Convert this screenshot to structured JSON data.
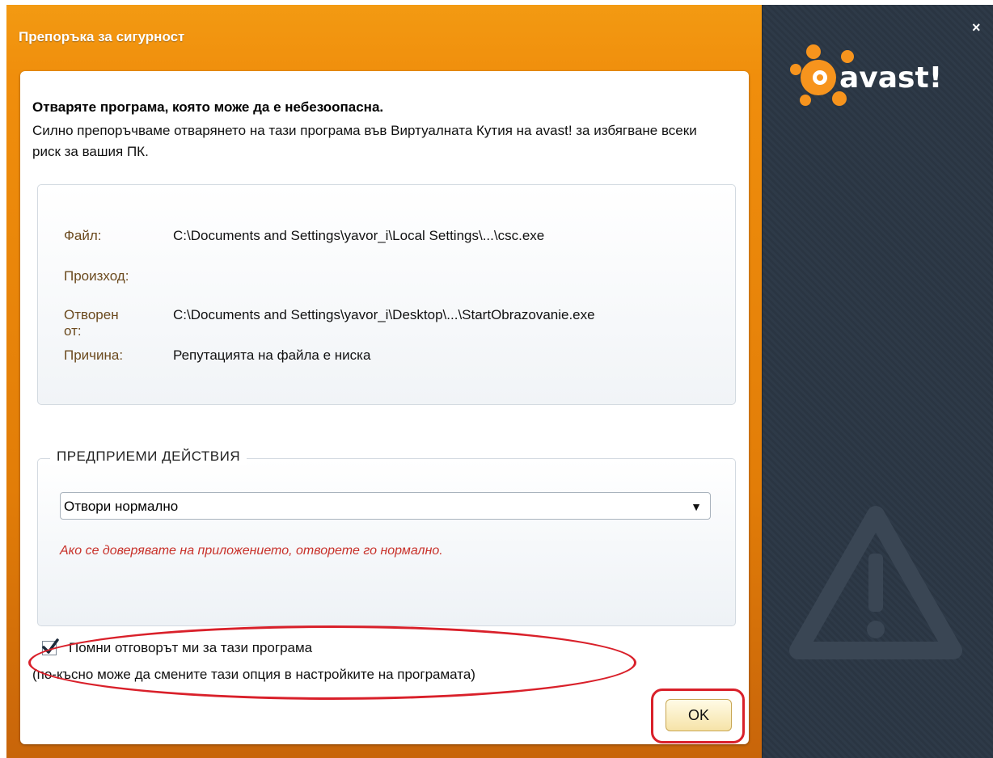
{
  "window": {
    "title": "Препоръка за сигурност",
    "close_glyph": "×",
    "brand": "avast!"
  },
  "message": {
    "heading": "Отваряте програма, която може да е небезоопасна.",
    "body": "Силно препоръчваме отварянето на тази програма във Виртуалната Кутия на avast! за избягване всеки риск за вашия ПК."
  },
  "details": [
    {
      "label": "Файл:",
      "value": "C:\\Documents and Settings\\yavor_i\\Local Settings\\...\\csc.exe"
    },
    {
      "label": "Произход:",
      "value": ""
    },
    {
      "label": "Отворен от:",
      "value": "C:\\Documents and Settings\\yavor_i\\Desktop\\...\\StartObrazovanie.exe"
    },
    {
      "label": "Причина:",
      "value": "Репутацията на файла е ниска"
    }
  ],
  "actions": {
    "legend": "ПРЕДПРИЕМИ ДЕЙСТВИЯ",
    "selected": "Отвори нормално",
    "hint": "Ако се доверявате на приложението, отворете го нормално."
  },
  "remember": {
    "label": "Помни отговорът ми за тази програма",
    "checked": true,
    "note": "(по-късно може да смените тази опция в настройките на програмата)"
  },
  "ok_label": "OK",
  "colors": {
    "accent": "#f39a12",
    "side_panel": "#2e3a48",
    "highlight": "#d9202a",
    "hint_text": "#c8312a"
  }
}
